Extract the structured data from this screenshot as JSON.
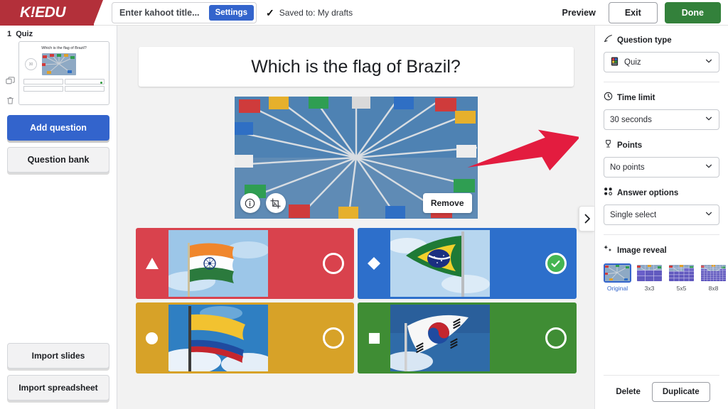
{
  "header": {
    "brand": "K!EDU",
    "title_placeholder": "Enter kahoot title...",
    "settings_label": "Settings",
    "saved_text": "Saved to: My drafts",
    "check_glyph": "✓",
    "preview_label": "Preview",
    "exit_label": "Exit",
    "done_label": "Done",
    "settings_color": "#3364cc",
    "done_color": "#33813b",
    "brand_color": "#b3303a"
  },
  "sidebar": {
    "question_index": "1",
    "question_kind": "Quiz",
    "thumbnail": {
      "question": "Which is the flag of Brazil?",
      "timer": "30"
    },
    "add_question_label": "Add question",
    "question_bank_label": "Question bank",
    "import_slides_label": "Import slides",
    "import_spreadsheet_label": "Import spreadsheet",
    "duplicate_icon": "duplicate-icon",
    "delete_icon": "trash-icon"
  },
  "canvas": {
    "question_text": "Which is the flag of Brazil?",
    "remove_label": "Remove",
    "info_icon": "info-icon",
    "crop_icon": "image-crop-icon",
    "panel_toggle_glyph": "›",
    "annotation_arrow_color": "#e31c3f",
    "answers": [
      {
        "shape": "triangle",
        "color": "#d9424d",
        "flag": "india",
        "correct": false,
        "text": ""
      },
      {
        "shape": "diamond",
        "color": "#2d6fcb",
        "flag": "brazil",
        "correct": true,
        "text": ""
      },
      {
        "shape": "circle",
        "color": "#d7a228",
        "flag": "colombia",
        "correct": false,
        "text": ""
      },
      {
        "shape": "square",
        "color": "#3f8d34",
        "flag": "southkorea",
        "correct": false,
        "text": ""
      }
    ]
  },
  "right_panel": {
    "question_type": {
      "label": "Question type",
      "icon": "question-type-icon",
      "value": "Quiz"
    },
    "time_limit": {
      "label": "Time limit",
      "icon": "clock-icon",
      "value": "30 seconds"
    },
    "points": {
      "label": "Points",
      "icon": "trophy-icon",
      "value": "No points"
    },
    "answer_options": {
      "label": "Answer options",
      "icon": "answer-options-icon",
      "value": "Single select"
    },
    "image_reveal": {
      "label": "Image reveal",
      "icon": "sparkle-icon",
      "options": [
        {
          "label": "Original",
          "grid": 0,
          "selected": true
        },
        {
          "label": "3x3",
          "grid": 3,
          "selected": false
        },
        {
          "label": "5x5",
          "grid": 5,
          "selected": false
        },
        {
          "label": "8x8",
          "grid": 8,
          "selected": false
        }
      ]
    },
    "delete_label": "Delete",
    "duplicate_label": "Duplicate"
  }
}
